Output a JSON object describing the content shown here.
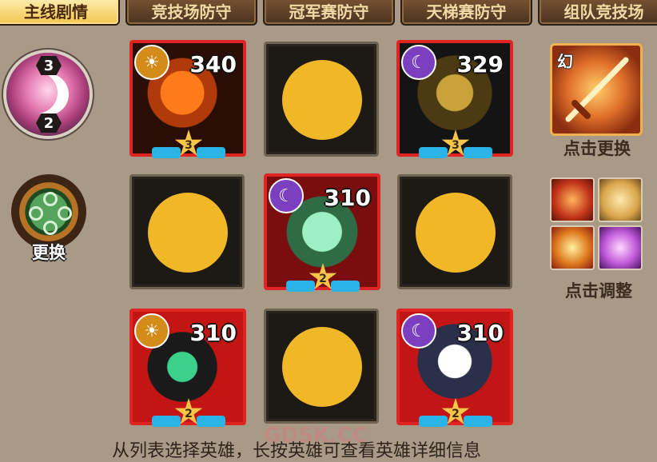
{
  "tabs": [
    {
      "label": "主线剧情",
      "active": true
    },
    {
      "label": "竞技场防守",
      "active": false
    },
    {
      "label": "冠军赛防守",
      "active": false
    },
    {
      "label": "天梯赛防守",
      "active": false
    },
    {
      "label": "组队竞技场",
      "active": false
    }
  ],
  "phase_badge": {
    "top_number": "3",
    "bottom_number": "2",
    "icon": "crescent-moon-icon"
  },
  "rune_badge": {
    "label": "更换",
    "icon": "rune-circle-icon"
  },
  "grid": [
    [
      {
        "type": "hero",
        "element": "sun",
        "power": "340",
        "stars": "3"
      },
      {
        "type": "empty"
      },
      {
        "type": "hero",
        "element": "moon",
        "power": "329",
        "stars": "3"
      }
    ],
    [
      {
        "type": "empty"
      },
      {
        "type": "hero",
        "element": "moon",
        "power": "310",
        "stars": "2"
      },
      {
        "type": "empty"
      }
    ],
    [
      {
        "type": "hero",
        "element": "sun",
        "power": "310",
        "stars": "2"
      },
      {
        "type": "empty"
      },
      {
        "type": "hero",
        "element": "moon",
        "power": "310",
        "stars": "2"
      }
    ]
  ],
  "weapon": {
    "tag": "幻",
    "caption": "点击更换",
    "icon": "sword-icon"
  },
  "skills": {
    "caption": "点击调整",
    "icons": [
      "fire-slash-icon",
      "golden-aura-icon",
      "holy-cross-icon",
      "lotus-icon"
    ]
  },
  "footer_text": "从列表选择英雄，长按英雄可查看英雄详细信息",
  "watermark": "GDSK.CC",
  "colors": {
    "accent_tab": "#f2c54f",
    "hero_frame": "#e02424",
    "empty_emblem": "#f0b726"
  }
}
